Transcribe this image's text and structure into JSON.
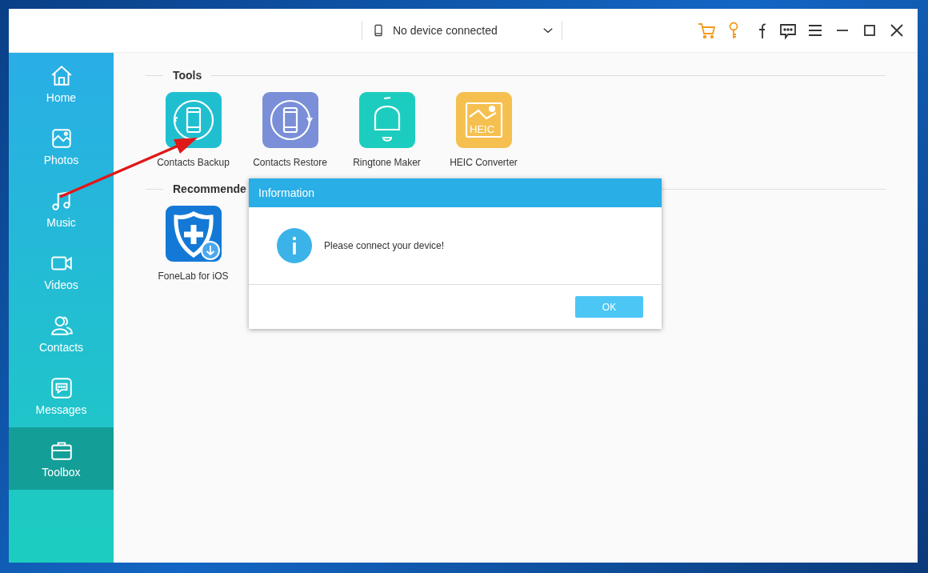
{
  "title_bar": {
    "device": "No device connected"
  },
  "sidebar": {
    "items": [
      {
        "label": "Home",
        "selected": false
      },
      {
        "label": "Photos",
        "selected": false
      },
      {
        "label": "Music",
        "selected": false
      },
      {
        "label": "Videos",
        "selected": false
      },
      {
        "label": "Contacts",
        "selected": false
      },
      {
        "label": "Messages",
        "selected": false
      },
      {
        "label": "Toolbox",
        "selected": true
      }
    ]
  },
  "sections": [
    {
      "title": "Tools",
      "items": [
        {
          "label": "Contacts Backup"
        },
        {
          "label": "Contacts Restore"
        },
        {
          "label": "Ringtone Maker"
        },
        {
          "label": "HEIC Converter",
          "icon_text": "HEIC"
        }
      ]
    },
    {
      "title": "Recommende",
      "items": [
        {
          "label": "FoneLab for iOS"
        }
      ]
    }
  ],
  "dialog": {
    "title": "Information",
    "message": "Please connect your device!",
    "button": "OK"
  }
}
